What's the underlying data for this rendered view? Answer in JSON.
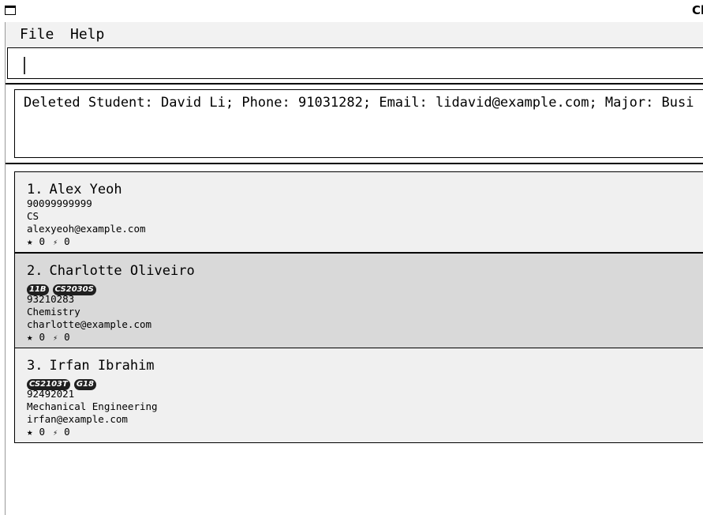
{
  "window": {
    "title": "Cl"
  },
  "menu": {
    "file": "File",
    "help": "Help"
  },
  "command": {
    "value": ""
  },
  "result": {
    "text": "Deleted Student: David Li; Phone: 91031282; Email: lidavid@example.com; Major: Busi"
  },
  "students": [
    {
      "index": "1.",
      "name": "Alex Yeoh",
      "tags": [],
      "phone": "90099999999",
      "major": "CS",
      "email": "alexyeoh@example.com",
      "star_icon": "★",
      "stars": "0",
      "bolt_icon": "⚡",
      "bolts": "0",
      "selected": false
    },
    {
      "index": "2.",
      "name": "Charlotte Oliveiro",
      "tags": [
        "11B",
        "CS2030S"
      ],
      "phone": "93210283",
      "major": "Chemistry",
      "email": "charlotte@example.com",
      "star_icon": "★",
      "stars": "0",
      "bolt_icon": "⚡",
      "bolts": "0",
      "selected": true
    },
    {
      "index": "3.",
      "name": "Irfan Ibrahim",
      "tags": [
        "CS2103T",
        "G18"
      ],
      "phone": "92492021",
      "major": "Mechanical Engineering",
      "email": "irfan@example.com",
      "star_icon": "★",
      "stars": "0",
      "bolt_icon": "⚡",
      "bolts": "0",
      "selected": false
    }
  ]
}
